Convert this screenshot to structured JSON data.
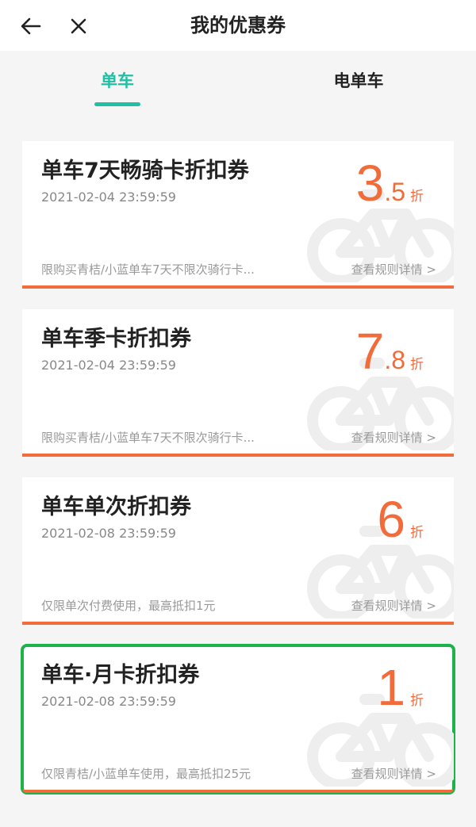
{
  "header": {
    "title": "我的优惠券"
  },
  "tabs": [
    {
      "label": "单车"
    },
    {
      "label": "电单车"
    }
  ],
  "coupons": [
    {
      "name": "单车7天畅骑卡折扣券",
      "date": "2021-02-04 23:59:59",
      "discount_int": "3",
      "discount_dec": ".5",
      "unit": "折",
      "description": "限购买青桔/小蓝单车7天不限次骑行卡...",
      "rules_label": "查看规则详情 >"
    },
    {
      "name": "单车季卡折扣券",
      "date": "2021-02-04 23:59:59",
      "discount_int": "7",
      "discount_dec": ".8",
      "unit": "折",
      "description": "限购买青桔/小蓝单车7天不限次骑行卡...",
      "rules_label": "查看规则详情 >"
    },
    {
      "name": "单车单次折扣券",
      "date": "2021-02-08 23:59:59",
      "discount_int": "6",
      "discount_dec": "",
      "unit": "折",
      "description": "仅限单次付费使用，最高抵扣1元",
      "rules_label": "查看规则详情 >"
    },
    {
      "name": "单车·月卡折扣券",
      "date": "2021-02-08 23:59:59",
      "discount_int": "1",
      "discount_dec": "",
      "unit": "折",
      "description": "仅限青桔/小蓝单车使用，最高抵扣25元",
      "rules_label": "查看规则详情 >"
    }
  ],
  "colors": {
    "accent": "#1fc0a3",
    "discount": "#f26b3a",
    "selected_outline": "#1bb34a"
  }
}
